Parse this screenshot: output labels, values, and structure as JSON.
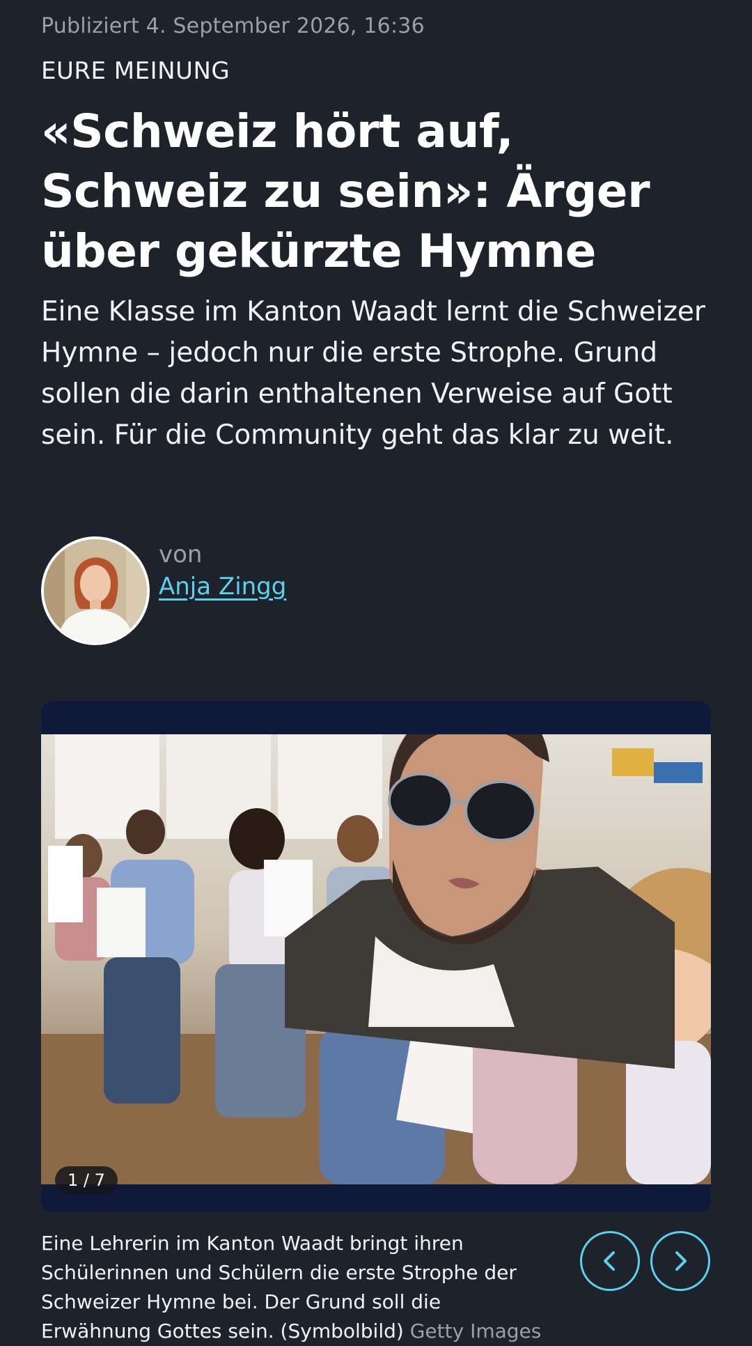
{
  "article": {
    "published": "Publiziert 4. September 2026, 16:36",
    "kicker": "EURE MEINUNG",
    "headline": "«Schweiz hört auf, Schweiz zu sein»: Ärger über gekürzte Hymne",
    "lead": "Eine Klasse im Kanton Waadt lernt die Schweizer Hymne – jedoch nur die erste Strophe. Grund sollen die darin enthaltenen Verweise auf Gott sein. Für die Community geht das klar zu weit."
  },
  "author": {
    "by_label": "von",
    "name": "Anja Zingg"
  },
  "gallery": {
    "counter": "1 / 7",
    "caption": "Eine Lehrerin im Kanton Waadt bringt ihren Schülerinnen und Schülern die erste Strophe der Schweizer Hymne bei. Der Grund soll die Erwähnung Gottes sein. (Symbolbild)",
    "credit": "Getty Images",
    "prev_icon": "chevron-left-icon",
    "next_icon": "chevron-right-icon"
  },
  "colors": {
    "background": "#1e222a",
    "accent": "#5ad2ef",
    "gallery_frame": "#0f1a3a",
    "muted_text": "#9aa0ab"
  }
}
